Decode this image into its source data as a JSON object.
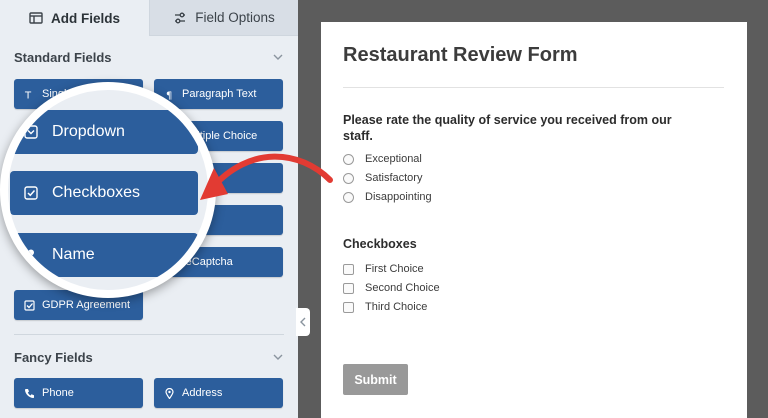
{
  "tabs": {
    "add_fields": "Add Fields",
    "field_options": "Field Options"
  },
  "standard_fields": {
    "title": "Standard Fields",
    "buttons": {
      "single_line": "Single Line Text",
      "paragraph": "Paragraph Text",
      "multiple_choice": "Multiple Choice",
      "recaptcha": "reCaptcha",
      "gdpr": "GDPR Agreement"
    },
    "magnified": {
      "dropdown": "Dropdown",
      "checkboxes": "Checkboxes",
      "name": "Name"
    }
  },
  "fancy_fields": {
    "title": "Fancy Fields",
    "buttons": {
      "phone": "Phone",
      "address": "Address"
    }
  },
  "form": {
    "title": "Restaurant Review Form",
    "question": "Please rate the quality of service you received from our staff.",
    "radio_options": [
      "Exceptional",
      "Satisfactory",
      "Disappointing"
    ],
    "checkbox_label": "Checkboxes",
    "checkbox_options": [
      "First Choice",
      "Second Choice",
      "Third Choice"
    ],
    "submit_label": "Submit"
  },
  "colors": {
    "field_button": "#2c5e9c",
    "arrow": "#e23b33",
    "panel": "#eaeef3"
  }
}
